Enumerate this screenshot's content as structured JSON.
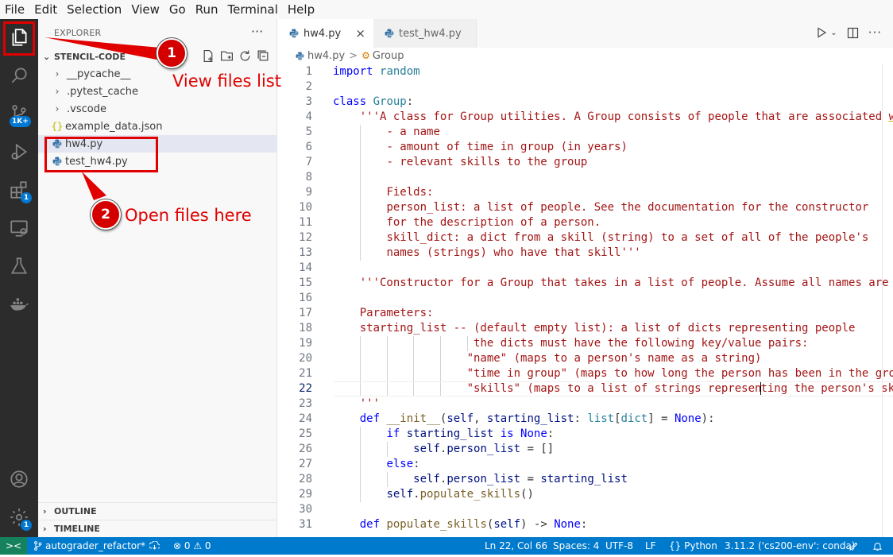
{
  "menu": [
    "File",
    "Edit",
    "Selection",
    "View",
    "Go",
    "Run",
    "Terminal",
    "Help"
  ],
  "activity_bar": {
    "items": [
      "explorer-icon",
      "search-icon",
      "source-control-icon",
      "run-debug-icon",
      "extensions-icon",
      "remote-explorer-icon",
      "testing-icon",
      "docker-icon"
    ],
    "source_control_badge": "1K+",
    "extensions_badge": "1",
    "manage_badge": "1",
    "bottom": [
      "account-icon",
      "manage-gear-icon"
    ]
  },
  "sidebar": {
    "title": "EXPLORER",
    "more": "···",
    "folder": "STENCIL-CODE",
    "tree": [
      {
        "label": "__pycache__",
        "kind": "folder"
      },
      {
        "label": ".pytest_cache",
        "kind": "folder"
      },
      {
        "label": ".vscode",
        "kind": "folder"
      },
      {
        "label": "example_data.json",
        "kind": "json"
      },
      {
        "label": "hw4.py",
        "kind": "python",
        "selected": true
      },
      {
        "label": "test_hw4.py",
        "kind": "python"
      }
    ],
    "outline": "OUTLINE",
    "timeline": "TIMELINE"
  },
  "tabs": [
    {
      "label": "hw4.py",
      "active": true,
      "close": "×"
    },
    {
      "label": "test_hw4.py",
      "active": false
    }
  ],
  "breadcrumb": {
    "file": "hw4.py",
    "separator": ">",
    "symbol": "Group"
  },
  "editor": {
    "current_line": 22,
    "lines": [
      {
        "n": "1",
        "code": "import random"
      },
      {
        "n": "2",
        "code": ""
      },
      {
        "n": "3",
        "code": "class Group:"
      },
      {
        "n": "4",
        "code": "    '''A class for Group utilities. A Group consists of people that are associated w"
      },
      {
        "n": "5",
        "code": "        - a name"
      },
      {
        "n": "6",
        "code": "        - amount of time in group (in years)"
      },
      {
        "n": "7",
        "code": "        - relevant skills to the group"
      },
      {
        "n": "8",
        "code": ""
      },
      {
        "n": "9",
        "code": "        Fields:"
      },
      {
        "n": "10",
        "code": "        person_list: a list of people. See the documentation for the constructor"
      },
      {
        "n": "11",
        "code": "        for the description of a person."
      },
      {
        "n": "12",
        "code": "        skill_dict: a dict from a skill (string) to a set of all of the people's"
      },
      {
        "n": "13",
        "code": "        names (strings) who have that skill'''"
      },
      {
        "n": "14",
        "code": ""
      },
      {
        "n": "15",
        "code": "    '''Constructor for a Group that takes in a list of people. Assume all names are"
      },
      {
        "n": "16",
        "code": ""
      },
      {
        "n": "17",
        "code": "    Parameters:"
      },
      {
        "n": "18",
        "code": "    starting_list -- (default empty list): a list of dicts representing people"
      },
      {
        "n": "19",
        "code": "                     the dicts must have the following key/value pairs:"
      },
      {
        "n": "20",
        "code": "                    \"name\" (maps to a person's name as a string)"
      },
      {
        "n": "21",
        "code": "                    \"time in group\" (maps to how long the person has been in the gro"
      },
      {
        "n": "22",
        "code": "                    \"skills\" (maps to a list of strings representing the person's sk"
      },
      {
        "n": "23",
        "code": "    '''"
      },
      {
        "n": "24",
        "code": "    def __init__(self, starting_list: list[dict] = None):"
      },
      {
        "n": "25",
        "code": "        if starting_list is None:"
      },
      {
        "n": "26",
        "code": "            self.person_list = []"
      },
      {
        "n": "27",
        "code": "        else:"
      },
      {
        "n": "28",
        "code": "            self.person_list = starting_list"
      },
      {
        "n": "29",
        "code": "        self.populate_skills()"
      },
      {
        "n": "30",
        "code": ""
      },
      {
        "n": "31",
        "code": "    def populate_skills(self) -> None:"
      }
    ]
  },
  "statusbar": {
    "remote": "><",
    "branch": "autograder_refactor*",
    "sync": "sync-icon",
    "problems": "⊗ 0 ⚠ 0",
    "position": "Ln 22, Col 66",
    "spaces": "Spaces: 4",
    "encoding": "UTF-8",
    "eol": "LF",
    "language": "Python",
    "interpreter": "3.11.2 ('cs200-env': conda)"
  },
  "annotations": {
    "callout1": {
      "number": "1",
      "text": "View files list"
    },
    "callout2": {
      "number": "2",
      "text": "Open files here"
    },
    "color": "#e00000"
  }
}
